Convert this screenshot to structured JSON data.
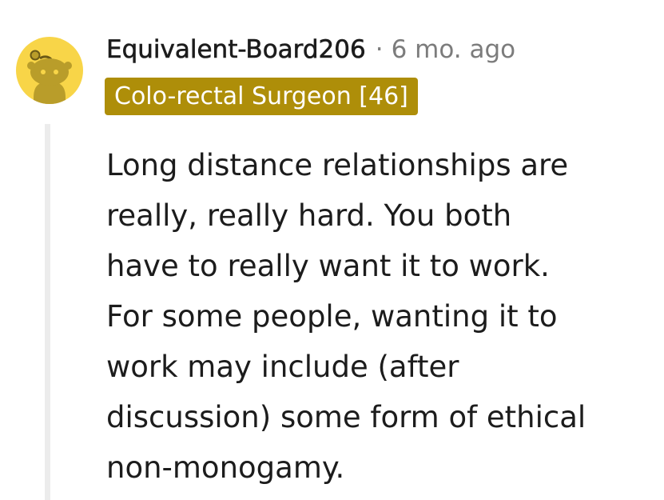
{
  "comment": {
    "author": "Equivalent-Board206",
    "separator": "·",
    "timestamp": "6 mo. ago",
    "flair": "Colo-rectal Surgeon [46]",
    "avatar_icon": "snoo-avatar-icon",
    "body_lines": [
      "Long distance relationships are",
      "really, really hard. You both",
      "have to really want it to work.",
      "For some people, wanting it to",
      "work may include (after",
      "discussion) some form of ethical",
      "non-monogamy."
    ]
  },
  "colors": {
    "avatar_background": "#f8d548",
    "flair_background": "#ae8e09",
    "meta_gray": "#7c7c7c",
    "thread_line": "#ececec"
  }
}
